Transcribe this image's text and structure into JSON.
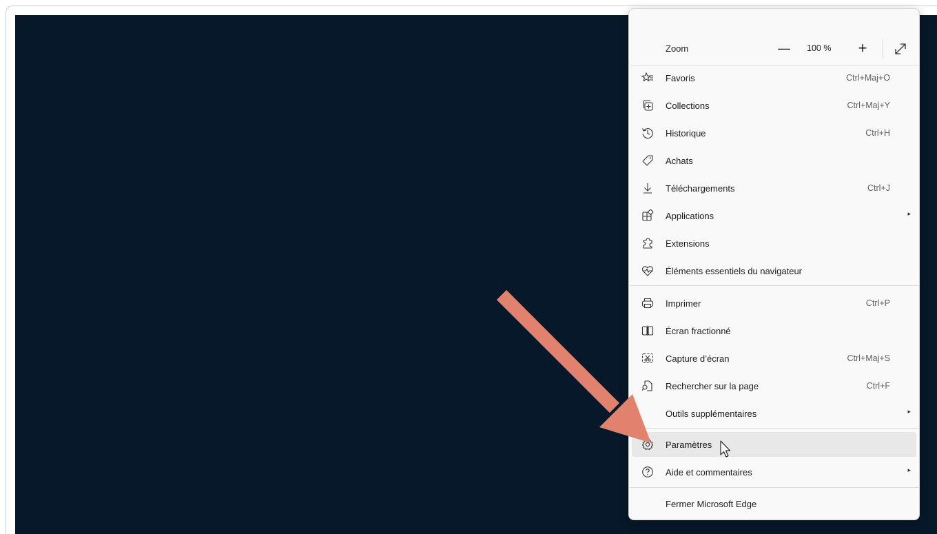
{
  "menu": {
    "zoom": {
      "label": "Zoom",
      "minus": "—",
      "value": "100 %",
      "plus": "+"
    },
    "items": [
      {
        "label": "Favoris",
        "shortcut": "Ctrl+Maj+O",
        "icon": "favorites-icon"
      },
      {
        "label": "Collections",
        "shortcut": "Ctrl+Maj+Y",
        "icon": "collections-icon"
      },
      {
        "label": "Historique",
        "shortcut": "Ctrl+H",
        "icon": "history-icon"
      },
      {
        "label": "Achats",
        "shortcut": "",
        "icon": "tag-icon"
      },
      {
        "label": "Téléchargements",
        "shortcut": "Ctrl+J",
        "icon": "download-icon"
      },
      {
        "label": "Applications",
        "shortcut": "",
        "icon": "apps-icon",
        "submenu": "▸"
      },
      {
        "label": "Extensions",
        "shortcut": "",
        "icon": "puzzle-icon"
      },
      {
        "label": "Éléments essentiels du navigateur",
        "shortcut": "",
        "icon": "heart-pulse-icon"
      },
      {
        "label": "Imprimer",
        "shortcut": "Ctrl+P",
        "icon": "printer-icon"
      },
      {
        "label": "Écran fractionné",
        "shortcut": "",
        "icon": "split-screen-icon"
      },
      {
        "label": "Capture d’écran",
        "shortcut": "Ctrl+Maj+S",
        "icon": "screenshot-icon"
      },
      {
        "label": "Rechercher sur la page",
        "shortcut": "Ctrl+F",
        "icon": "find-icon"
      },
      {
        "label": "Outils supplémentaires",
        "shortcut": "",
        "icon": "",
        "submenu": "▸"
      },
      {
        "label": "Paramètres",
        "shortcut": "",
        "icon": "gear-icon"
      },
      {
        "label": "Aide et commentaires",
        "shortcut": "",
        "icon": "help-icon",
        "submenu": "▸"
      },
      {
        "label": "Fermer Microsoft Edge",
        "shortcut": "",
        "icon": ""
      }
    ]
  },
  "colors": {
    "page_background": "#07182a",
    "menu_background": "#f9f9f9",
    "hover_background": "#e8e8e8",
    "arrow": "#e0826e"
  }
}
